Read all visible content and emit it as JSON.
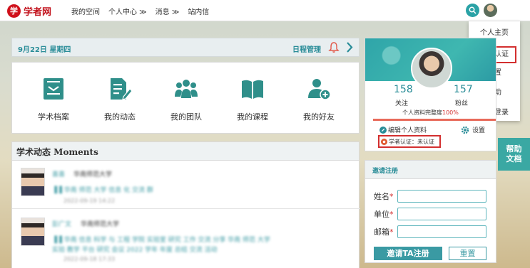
{
  "header": {
    "logo_mark": "学",
    "logo_text": "学者网",
    "nav": [
      "我的空间",
      "个人中心 ≫",
      "消息 ≫",
      "站内信"
    ]
  },
  "user_menu": {
    "items": [
      "个人主页",
      "学者认证",
      "设置",
      "帮助",
      "退出登录"
    ],
    "highlighted": "学者认证"
  },
  "date_bar": {
    "date": "9月22日  星期四",
    "schedule_link": "日程管理"
  },
  "apps": [
    "学术档案",
    "我的动态",
    "我的团队",
    "我的课程",
    "我的好友"
  ],
  "moments": {
    "title": "学术动态 Moments",
    "items": [
      {
        "name": "喜喜",
        "org": "华南师范大学",
        "line1": "▐▐ 华南 师范 大学 信息 化 交流 群",
        "time": "2022-09-19 14:22"
      },
      {
        "name": "彭广文",
        "org": "华南师范大学",
        "line1": "▐▐ 华南 信息 科学 与 工程 学院 实验室 研究 工作 交流 分享 华南 师范 大学",
        "line2": "实验 教学 平台 研究 会议 2022 学年 年度 总结 交流 活动",
        "time": "2022-09-18 17:33"
      }
    ]
  },
  "profile": {
    "followers_label": "关注",
    "followers": "158",
    "fans_label": "粉丝",
    "fans": "157",
    "completeness_label": "个人资料完整度",
    "completeness": "100%",
    "completeness_value": 1.0,
    "edit_label": "编辑个人资料",
    "settings_label": "设置",
    "auth_status": "学者认证：未认证"
  },
  "help_doc": [
    "帮助",
    "文档"
  ],
  "invite": {
    "title": "邀请注册",
    "fields": [
      "姓名",
      "单位",
      "邮箱"
    ],
    "submit": "邀请TA注册",
    "reset": "重置"
  },
  "colors": {
    "accent": "#2a8d98",
    "brand": "#c2121c",
    "alert": "#d32f2f"
  }
}
